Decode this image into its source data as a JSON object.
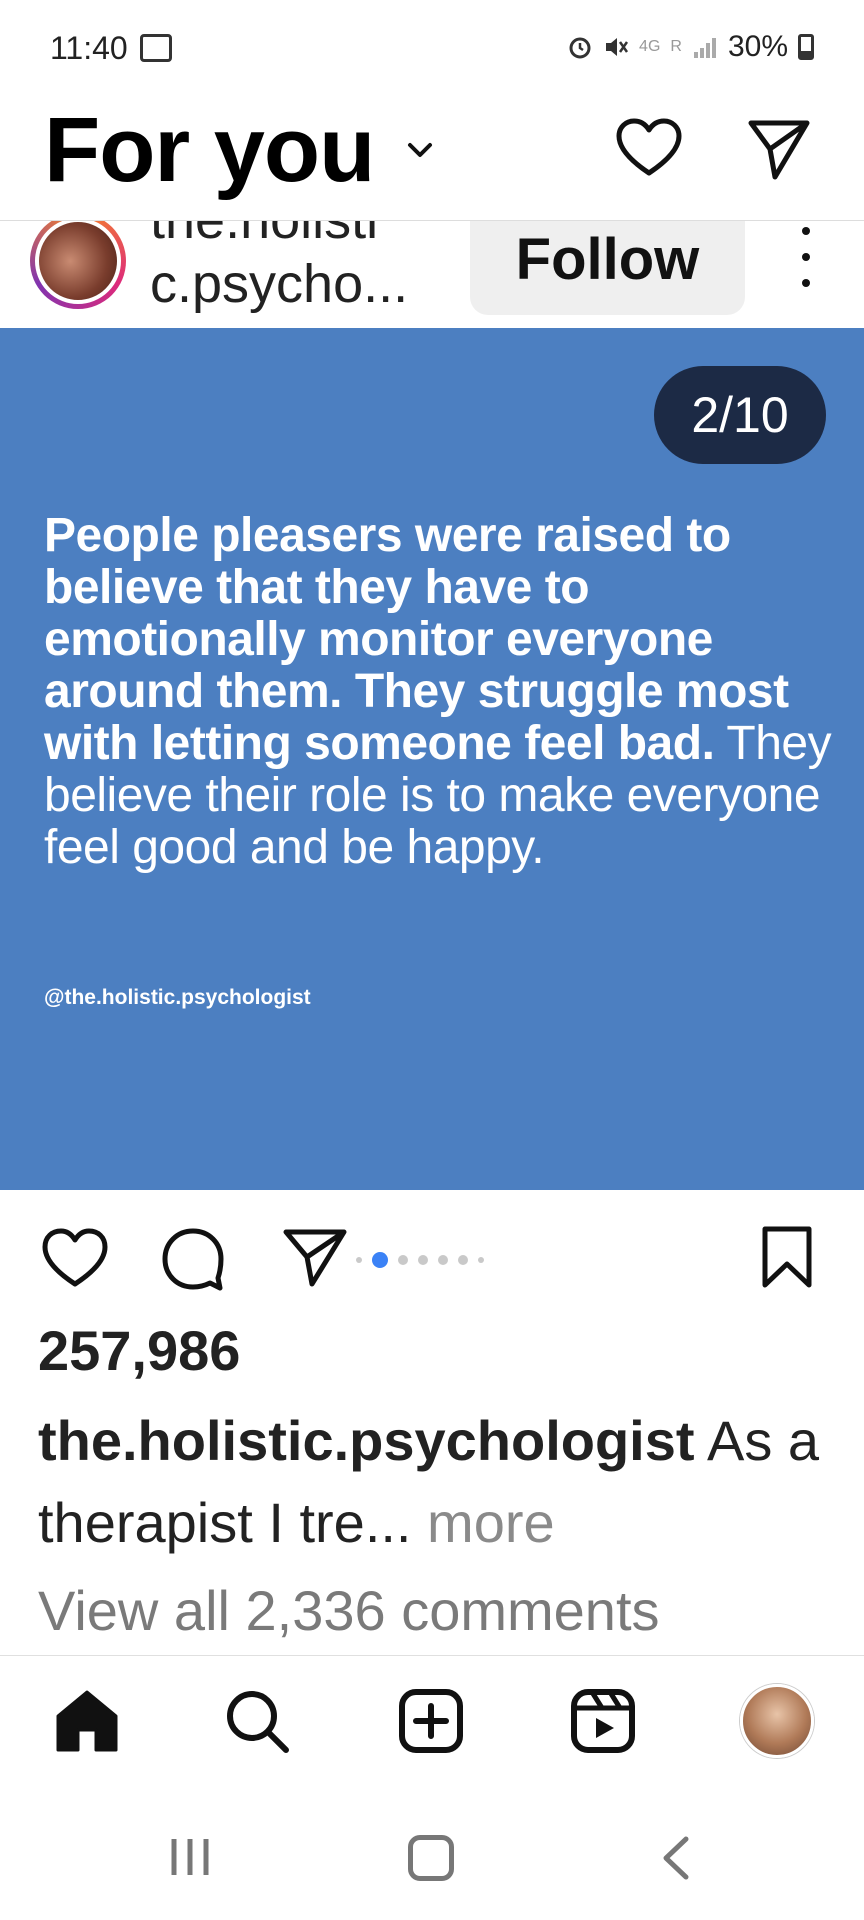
{
  "status_bar": {
    "time": "11:40",
    "network": "4G",
    "roaming": "R",
    "battery": "30%",
    "icons": [
      "notification-icon",
      "alarm-icon",
      "mute-icon",
      "signal-icon",
      "battery-icon"
    ]
  },
  "header": {
    "title": "For you",
    "icons": [
      "chevron-down-icon",
      "heart-icon",
      "send-icon"
    ]
  },
  "post": {
    "author_line1": "the.holisti",
    "author_line2": "c.psycho...",
    "follow_label": "Follow",
    "page_counter": "2/10",
    "quote_bold": "People pleasers were raised to believe that they have to emotionally monitor everyone around them. They struggle most with letting someone feel bad.",
    "quote_regular": " They believe their role is to make everyone feel good and be happy.",
    "quote_handle": "@the.holistic.psychologist",
    "image_color": "#4c7fc1",
    "likes": "257,986",
    "caption_user": "the.holistic.psychologist",
    "caption_text": " As a therapist I tre...",
    "caption_more": " more",
    "view_comments": "View all 2,336 comments",
    "carousel_active_index": 1
  },
  "bottom_nav": {
    "items": [
      "home-icon",
      "search-icon",
      "create-icon",
      "reels-icon",
      "profile-avatar"
    ]
  },
  "accent_color": "#3b82f6"
}
